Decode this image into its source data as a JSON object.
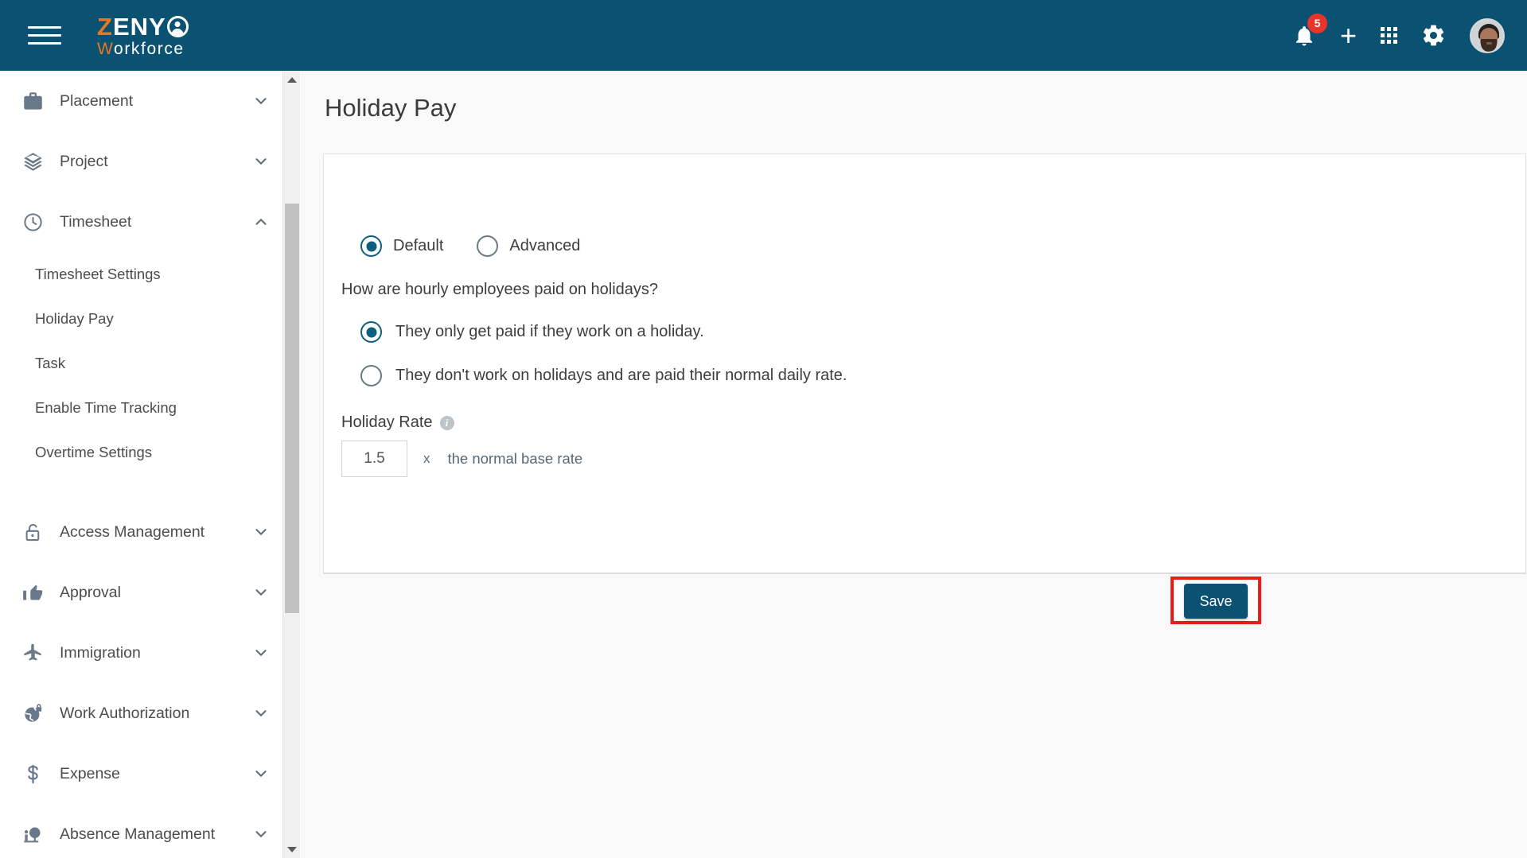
{
  "header": {
    "menu_icon": "hamburger-icon",
    "logo": {
      "part1": "Z",
      "part2": "ENY",
      "part3": "W",
      "part4": "orkforce"
    },
    "notification_count": "5",
    "icons": [
      "bell-icon",
      "plus-icon",
      "apps-grid-icon",
      "gear-icon",
      "avatar"
    ]
  },
  "sidebar": {
    "items": [
      {
        "label": "Placement",
        "icon": "briefcase-icon",
        "chevron": "down"
      },
      {
        "label": "Project",
        "icon": "layers-icon",
        "chevron": "down"
      },
      {
        "label": "Timesheet",
        "icon": "clock-icon",
        "chevron": "up"
      }
    ],
    "sub_items": [
      {
        "label": "Timesheet Settings"
      },
      {
        "label": "Holiday Pay"
      },
      {
        "label": "Task"
      },
      {
        "label": "Enable Time Tracking"
      },
      {
        "label": "Overtime Settings"
      }
    ],
    "items_after": [
      {
        "label": "Access Management",
        "icon": "lock-icon",
        "chevron": "down"
      },
      {
        "label": "Approval",
        "icon": "thumbs-up-icon",
        "chevron": "down"
      },
      {
        "label": "Immigration",
        "icon": "airplane-icon",
        "chevron": "down"
      },
      {
        "label": "Work Authorization",
        "icon": "globe-lock-icon",
        "chevron": "down"
      },
      {
        "label": "Expense",
        "icon": "dollar-icon",
        "chevron": "down"
      },
      {
        "label": "Absence Management",
        "icon": "person-tree-icon",
        "chevron": "down"
      }
    ]
  },
  "main": {
    "title": "Holiday Pay",
    "mode_options": [
      {
        "label": "Default",
        "selected": true
      },
      {
        "label": "Advanced",
        "selected": false
      }
    ],
    "question": "How are hourly employees paid on holidays?",
    "pay_options": [
      {
        "label": "They only get paid if they work on a holiday.",
        "selected": true
      },
      {
        "label": "They don't work on holidays and are paid their normal daily rate.",
        "selected": false
      }
    ],
    "rate_label": "Holiday Rate",
    "rate_value": "1.5",
    "rate_multiplier_symbol": "x",
    "rate_suffix": "the normal base rate",
    "save_label": "Save"
  },
  "colors": {
    "brand_dark": "#0b5272",
    "brand_orange": "#e87722",
    "accent_teal": "#0d5f80",
    "highlight_red": "#ee1b18",
    "badge_red": "#e8342a"
  }
}
